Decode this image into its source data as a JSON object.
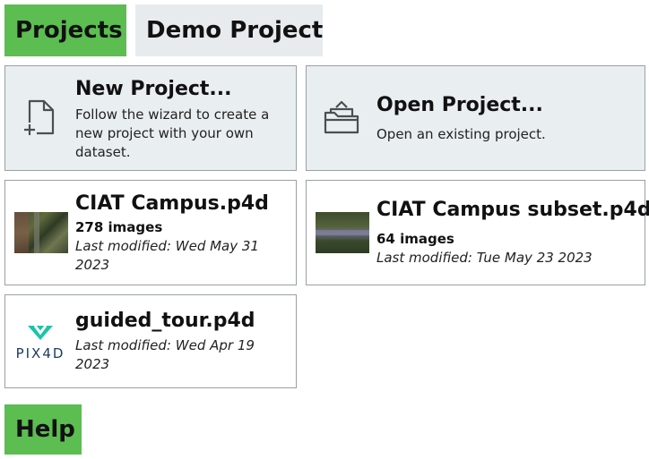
{
  "tabs": {
    "projects_label": "Projects",
    "demo_label": "Demo Project"
  },
  "actions": {
    "new_project": {
      "title": "New Project...",
      "description": "Follow the wizard to create a new project with your own dataset.",
      "icon": "new-file-icon"
    },
    "open_project": {
      "title": "Open Project...",
      "description": "Open an existing project.",
      "icon": "open-folder-icon"
    }
  },
  "recent_projects": [
    {
      "title": "CIAT Campus.p4d",
      "images": "278 images",
      "modified": "Last modified: Wed May 31 2023"
    },
    {
      "title": "CIAT Campus subset.p4d",
      "images": "64 images",
      "modified": "Last modified: Tue May 23 2023"
    },
    {
      "title": "guided_tour.p4d",
      "modified": "Last modified: Wed Apr 19 2023",
      "logo_text": "PIX4D"
    }
  ],
  "help": {
    "label": "Help"
  },
  "colors": {
    "accent_green": "#5cbd51",
    "tab_gray": "#e7ebee",
    "action_card_bg": "#e9eef1",
    "logo_teal": "#1ec3a8",
    "logo_navy": "#1d3a5c"
  }
}
